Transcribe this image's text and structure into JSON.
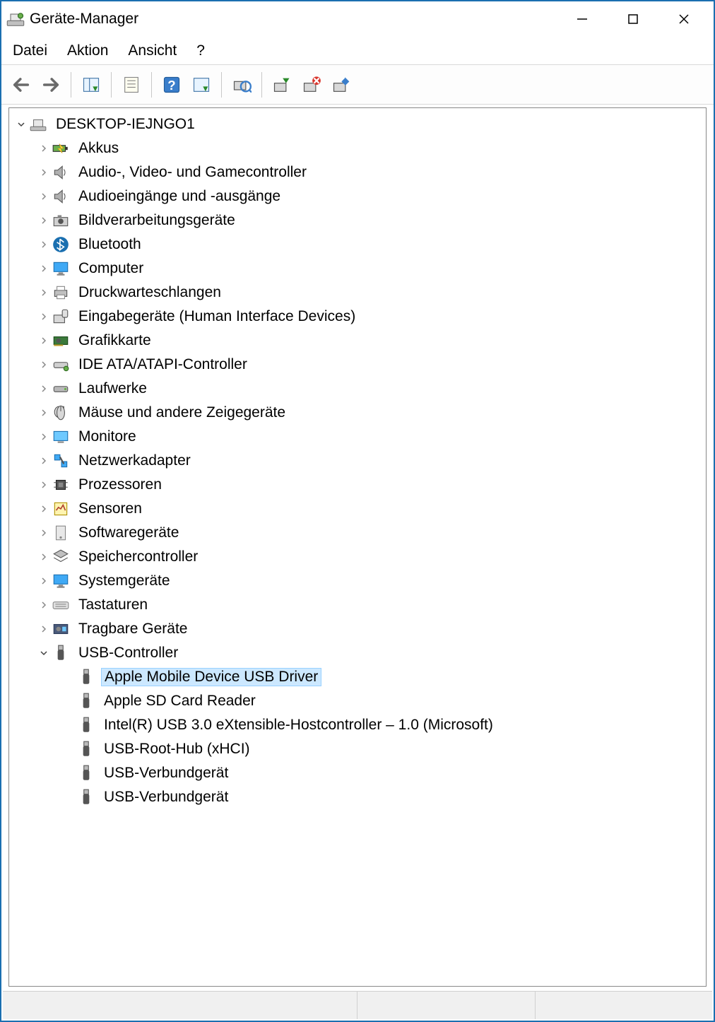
{
  "window": {
    "title": "Geräte-Manager"
  },
  "menu": {
    "file": "Datei",
    "action": "Aktion",
    "view": "Ansicht",
    "help": "?"
  },
  "tree": {
    "root": "DESKTOP-IEJNGO1",
    "categories": [
      {
        "label": "Akkus",
        "icon": "battery"
      },
      {
        "label": "Audio-, Video- und Gamecontroller",
        "icon": "speaker"
      },
      {
        "label": "Audioeingänge und -ausgänge",
        "icon": "speaker"
      },
      {
        "label": "Bildverarbeitungsgeräte",
        "icon": "camera"
      },
      {
        "label": "Bluetooth",
        "icon": "bluetooth"
      },
      {
        "label": "Computer",
        "icon": "monitor"
      },
      {
        "label": "Druckwarteschlangen",
        "icon": "printer"
      },
      {
        "label": "Eingabegeräte (Human Interface Devices)",
        "icon": "hid"
      },
      {
        "label": "Grafikkarte",
        "icon": "gpu"
      },
      {
        "label": "IDE ATA/ATAPI-Controller",
        "icon": "ide"
      },
      {
        "label": "Laufwerke",
        "icon": "drive"
      },
      {
        "label": "Mäuse und andere Zeigegeräte",
        "icon": "mouse"
      },
      {
        "label": "Monitore",
        "icon": "display"
      },
      {
        "label": "Netzwerkadapter",
        "icon": "network"
      },
      {
        "label": "Prozessoren",
        "icon": "cpu"
      },
      {
        "label": "Sensoren",
        "icon": "sensor"
      },
      {
        "label": "Softwaregeräte",
        "icon": "software"
      },
      {
        "label": "Speichercontroller",
        "icon": "storage"
      },
      {
        "label": "Systemgeräte",
        "icon": "monitor"
      },
      {
        "label": "Tastaturen",
        "icon": "keyboard"
      },
      {
        "label": "Tragbare Geräte",
        "icon": "portable"
      }
    ],
    "usb": {
      "label": "USB-Controller",
      "children": [
        {
          "label": "Apple Mobile Device USB Driver",
          "selected": true
        },
        {
          "label": "Apple SD Card Reader"
        },
        {
          "label": "Intel(R) USB 3.0 eXtensible-Hostcontroller – 1.0 (Microsoft)"
        },
        {
          "label": "USB-Root-Hub (xHCI)"
        },
        {
          "label": "USB-Verbundgerät"
        },
        {
          "label": "USB-Verbundgerät"
        }
      ]
    }
  }
}
